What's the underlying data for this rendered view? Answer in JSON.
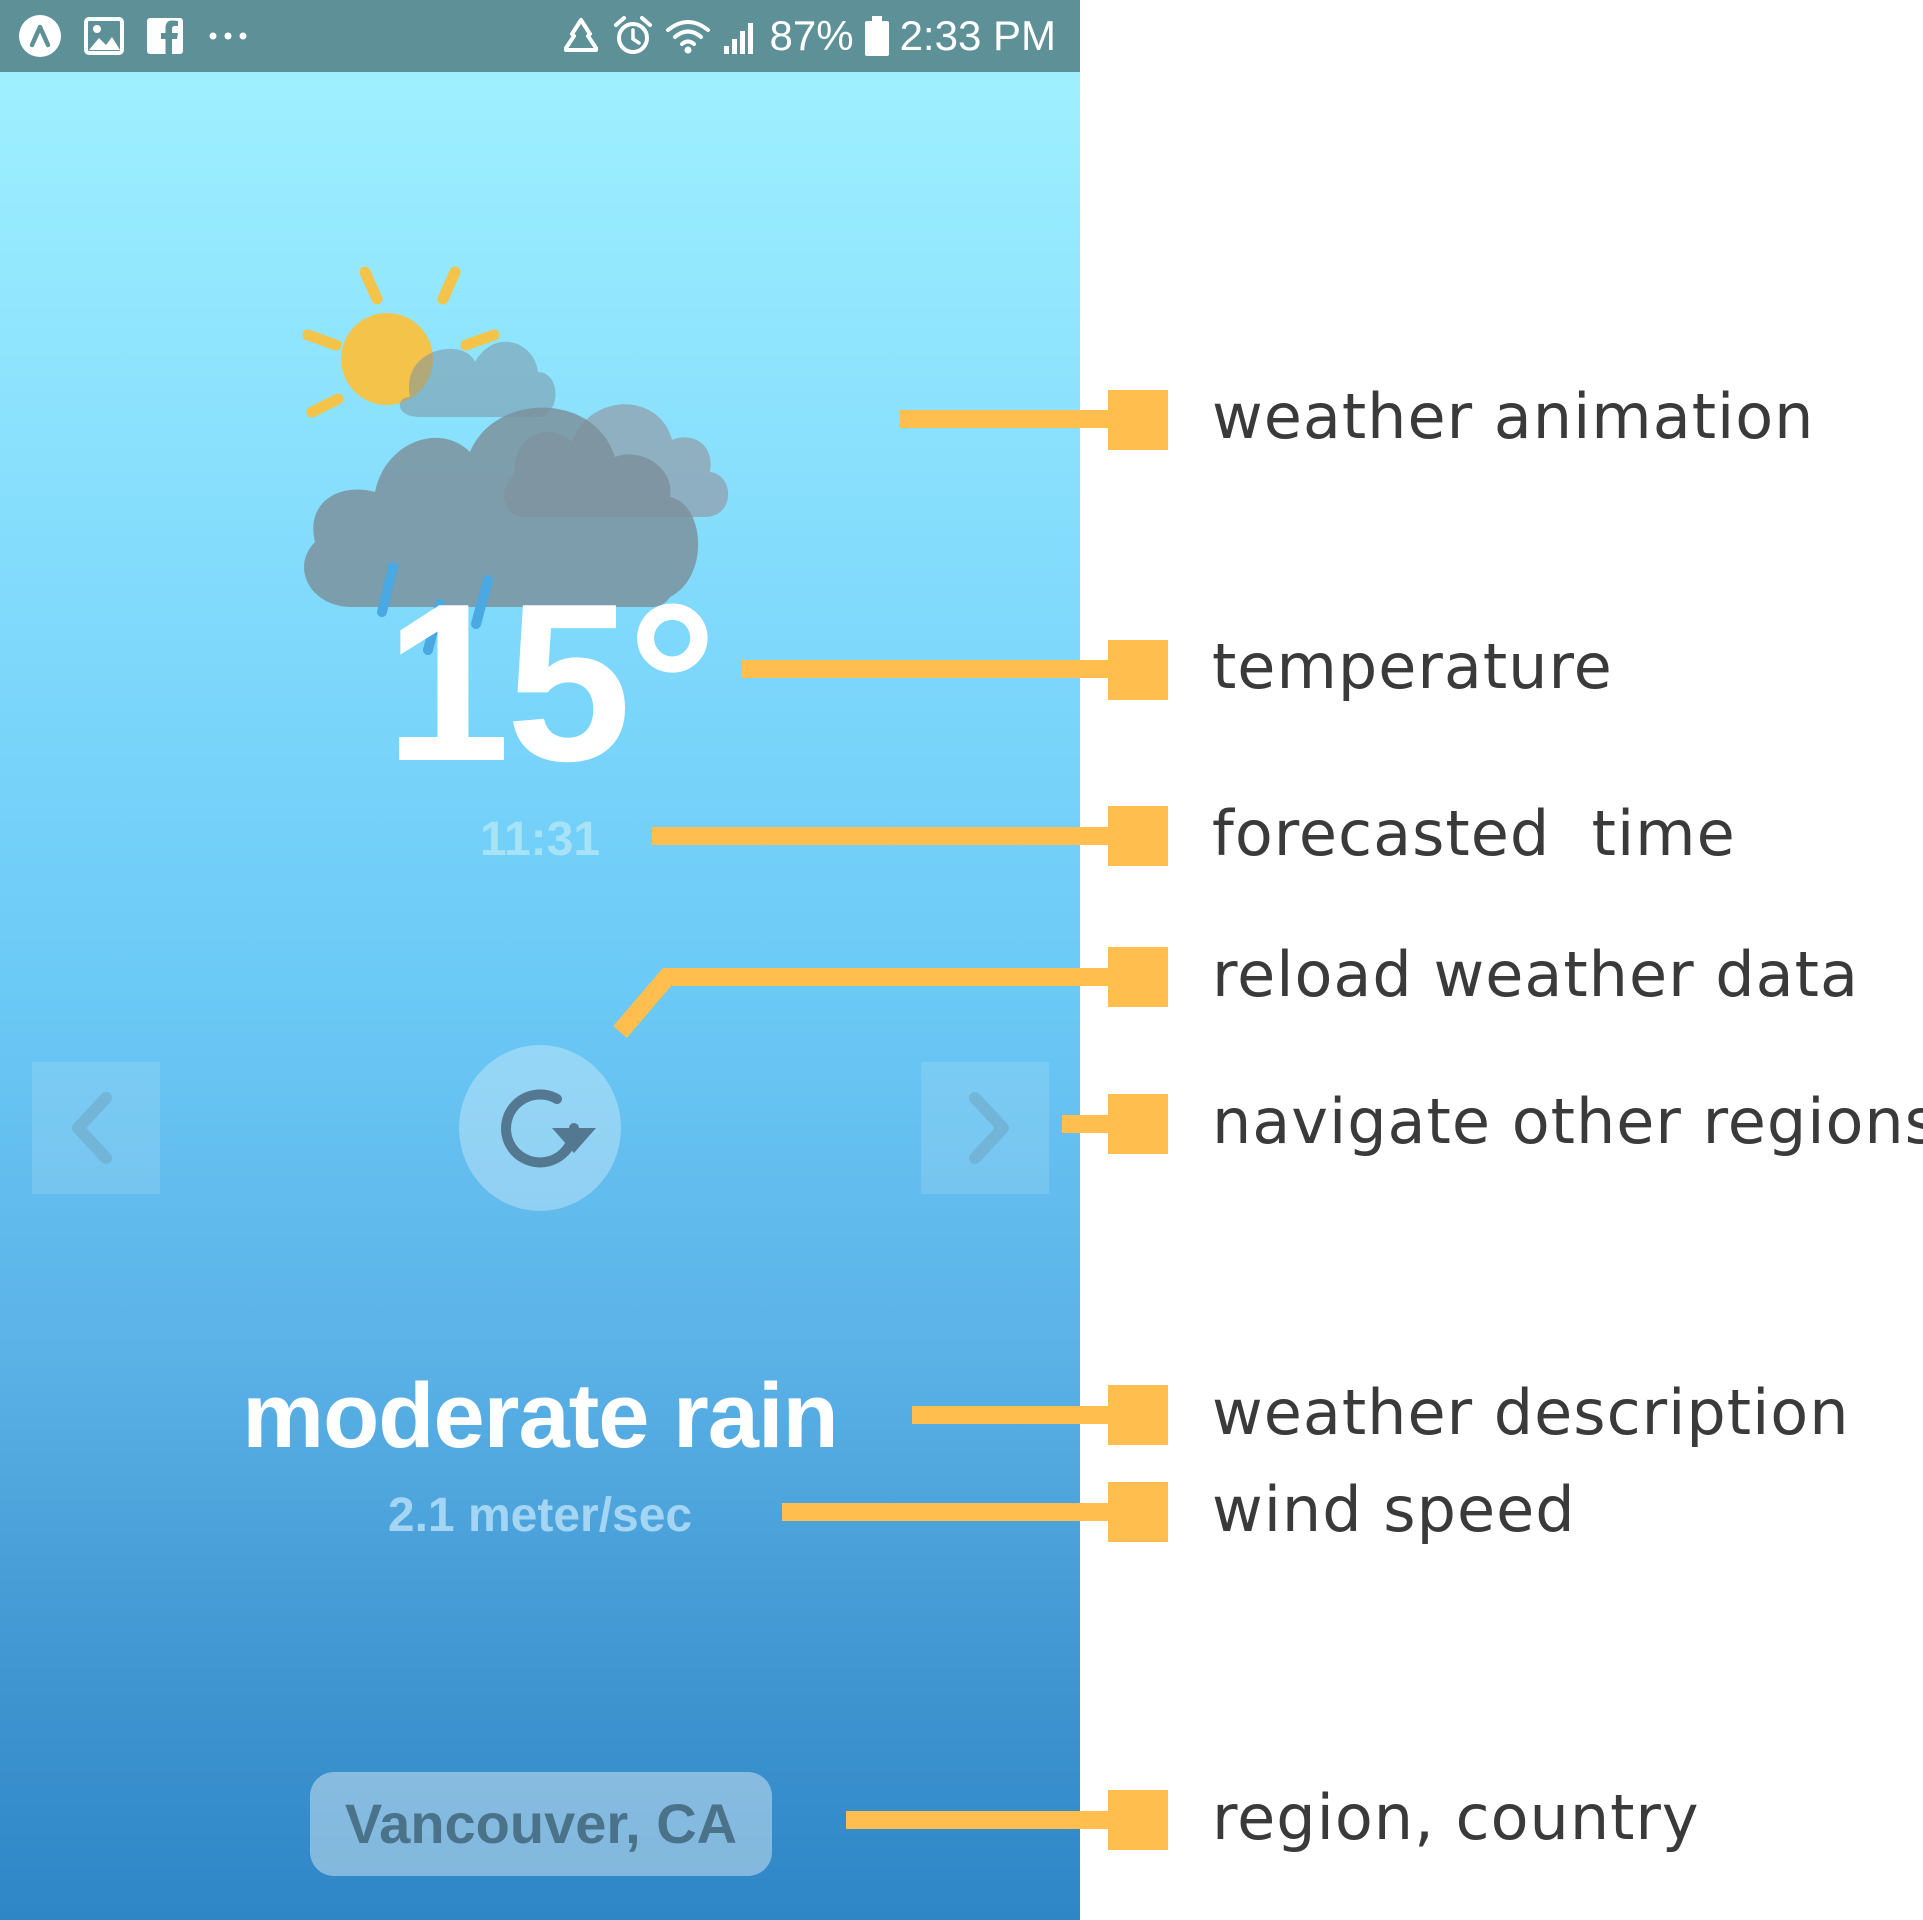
{
  "status_bar": {
    "battery": "87%",
    "time": "2:33 PM"
  },
  "weather": {
    "temperature": "15°",
    "forecast_time": "11:31",
    "description": "moderate rain",
    "wind_speed": "2.1 meter/sec",
    "region": "Vancouver, CA"
  },
  "annotations": {
    "weather_animation": "weather animation",
    "temperature": "temperature",
    "forecasted_time": "forecasted  time",
    "reload": "reload weather data",
    "navigate": "navigate other regions",
    "description": "weather description",
    "wind_speed": "wind speed",
    "region": "region, country"
  },
  "colors": {
    "annotation_accent": "#ffbe4d",
    "status_bar": "#5e9197",
    "sky_top": "#9ff0ff",
    "sky_bottom": "#2e86c7"
  },
  "icons": [
    "arch-app-icon",
    "gallery-icon",
    "facebook-icon",
    "more-dots-icon",
    "recycle-icon",
    "alarm-icon",
    "wifi-icon",
    "signal-icon",
    "battery-icon",
    "sun-icon",
    "cloud-icon",
    "raindrop-icon",
    "reload-icon",
    "chevron-left-icon",
    "chevron-right-icon"
  ]
}
